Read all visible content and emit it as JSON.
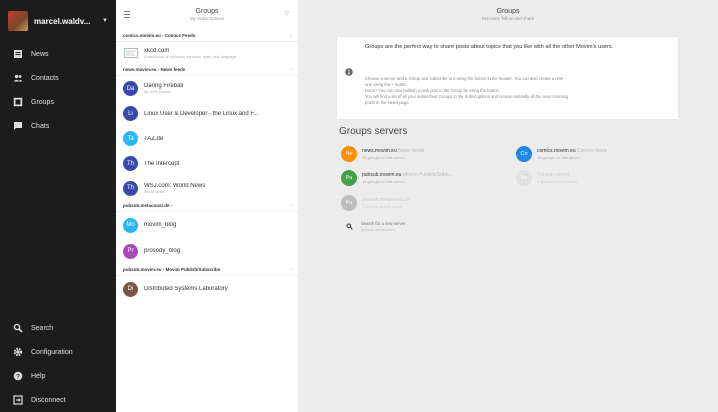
{
  "colors": {
    "nav_bg": "#1c1c1c",
    "main_bg": "#ececec",
    "accent_red": "#e53935"
  },
  "user": {
    "name": "marcel.waldv..."
  },
  "nav": {
    "items": [
      {
        "label": "News",
        "icon": "newspaper-icon"
      },
      {
        "label": "Contacts",
        "icon": "contacts-icon"
      },
      {
        "label": "Groups",
        "icon": "groups-icon"
      },
      {
        "label": "Chats",
        "icon": "chat-bubble-icon"
      }
    ],
    "bottom": [
      {
        "label": "Search",
        "icon": "search-icon"
      },
      {
        "label": "Configuration",
        "icon": "gear-icon"
      },
      {
        "label": "Help",
        "icon": "help-icon"
      },
      {
        "label": "Disconnect",
        "icon": "exit-icon"
      }
    ]
  },
  "list": {
    "title": "Groups",
    "subtitle": "My Subscriptions",
    "servers": [
      {
        "name": "comics.movim.eu - Comics Feeds",
        "groups": [
          {
            "initials": "",
            "icon": "comic-icon",
            "name": "xkcd.com",
            "desc": "A webcomic of romance, sarcasm, math, and language",
            "color": "#cfd8dc"
          }
        ]
      },
      {
        "name": "news.movim.eu - News feeds",
        "groups": [
          {
            "initials": "Da",
            "name": "Daring Fireball",
            "desc": "By John Gruber",
            "color": "#3949ab"
          },
          {
            "initials": "Li",
            "name": "Linux User & Developer - the Linux and F...",
            "desc": "",
            "color": "#3949ab"
          },
          {
            "initials": "Ta",
            "name": "TAZ.de",
            "desc": "",
            "color": "#29b6f6"
          },
          {
            "initials": "Th",
            "name": "The Intercept",
            "desc": "",
            "color": "#3949ab"
          },
          {
            "initials": "Th",
            "name": "WSJ.com: World News",
            "desc": "World News",
            "color": "#3949ab"
          }
        ]
      },
      {
        "name": "pubsub.metacoust.de -",
        "groups": [
          {
            "initials": "Mo",
            "name": "movim_blog",
            "desc": "",
            "color": "#29b6f6"
          },
          {
            "initials": "Pr",
            "name": "prosody_blog",
            "desc": "",
            "color": "#ab47bc"
          }
        ]
      },
      {
        "name": "pubsub.movim.eu - Movim Publish/Subscribe",
        "groups": [
          {
            "initials": "Di",
            "name": "Distributed Systems Laboratory",
            "desc": "",
            "color": "#795548"
          }
        ]
      }
    ]
  },
  "main": {
    "title": "Groups",
    "subtitle": "Discover, follow and share",
    "info": {
      "heading": "Groups are the perfect way to share posts about topics that you like with all the other Movim's users.",
      "lines": [
        "Choose a server and a Group and subscribe to it using the  button in the header. You can also create a new",
        "one using the + button.",
        "Done? You can now publish a new post in the Group by using the  button.",
        "You will find a list of all your subscribed Groups in My Subscriptions and receive instantly all the new incoming",
        "posts in the News page."
      ]
    },
    "servers_title": "Groups servers",
    "servers": [
      {
        "initials": "Ne",
        "name": "news.movim.eu",
        "desc": "News feeds",
        "count": "40 groups on this server",
        "color": "#ff8f00",
        "faded": false
      },
      {
        "initials": "Co",
        "name": "comics.movim.eu",
        "desc": "Comics feeds",
        "count": "18 groups on this server",
        "color": "#1e88e5",
        "faded": false
      },
      {
        "initials": "Pu",
        "name": "pubsub.movim.eu",
        "desc": "Movim Publish/Subs...",
        "count": "18 groups on this server",
        "color": "#43a047",
        "faded": false
      },
      {
        "initials": "Pu",
        "name": "Pubsub server",
        "desc": "",
        "count": "4 groups on this server",
        "color": "#e0e0e0",
        "faded": true
      },
      {
        "initials": "Pu",
        "name": "pubsub.metacoust.de",
        "desc": "",
        "count": "3 groups on this server",
        "color": "#bdbdbd",
        "faded": true
      }
    ],
    "search": {
      "label": "Search for a new server",
      "hint": "pubsub.server.com"
    }
  }
}
